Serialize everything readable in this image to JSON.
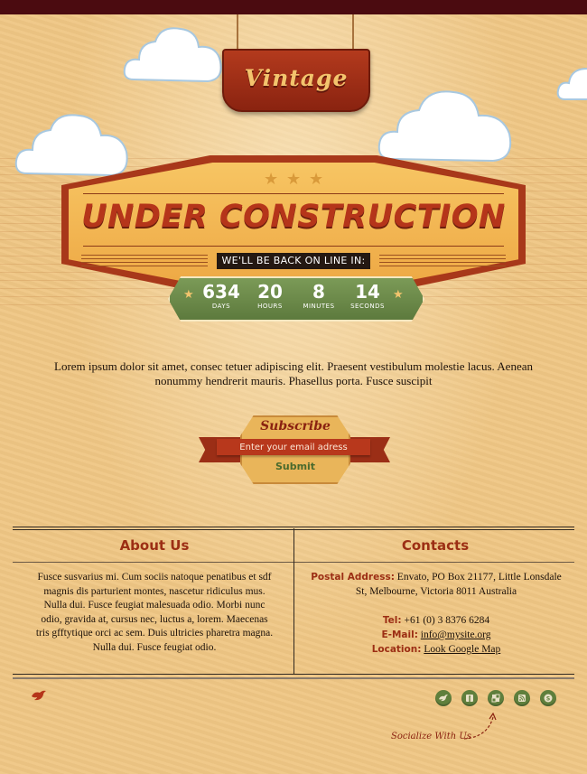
{
  "header": {
    "sign_text": "Vintage",
    "headline": "UNDER CONSTRUCTION",
    "back_text": "WE'LL BE BACK ON LINE IN:"
  },
  "countdown": [
    {
      "value": "634",
      "unit": "DAYS"
    },
    {
      "value": "20",
      "unit": "HOURS"
    },
    {
      "value": "8",
      "unit": "MINUTES"
    },
    {
      "value": "14",
      "unit": "SECONDS"
    }
  ],
  "intro_text": "Lorem ipsum dolor sit amet, consec tetuer adipiscing elit. Praesent vestibulum molestie lacus. Aenean nonummy hendrerit mauris. Phasellus porta. Fusce suscipit",
  "subscribe": {
    "title": "Subscribe",
    "placeholder": "Enter your email adress",
    "submit_label": "Submit"
  },
  "about": {
    "title": "About Us",
    "text": "Fusce susvarius mi. Cum sociis natoque penatibus et sdf magnis dis parturient montes, nascetur ridiculus mus. Nulla dui. Fusce feugiat malesuada odio. Morbi nunc odio, gravida at, cursus nec, luctus a, lorem. Maecenas tris gfftytique orci ac sem. Duis ultricies pharetra magna. Nulla dui. Fusce feugiat odio."
  },
  "contacts": {
    "title": "Contacts",
    "address_label": "Postal Address:",
    "address_value": "Envato, PO Box 21177, Little Lonsdale St, Melbourne, Victoria 8011 Australia",
    "tel_label": "Tel:",
    "tel_value": "+61 (0) 3 8376 6284",
    "email_label": "E-Mail:",
    "email_value": "info@mysite.org",
    "location_label": "Location:",
    "location_value": "Look Google Map"
  },
  "social": {
    "caption": "Socialize With Us",
    "icons": [
      "twitter-icon",
      "facebook-icon",
      "delicious-icon",
      "rss-icon",
      "skype-icon"
    ]
  },
  "colors": {
    "background": "#efc684",
    "top_bar": "#4b0b10",
    "accent_red": "#b5351a",
    "ribbon_green": "#6b8a48"
  }
}
